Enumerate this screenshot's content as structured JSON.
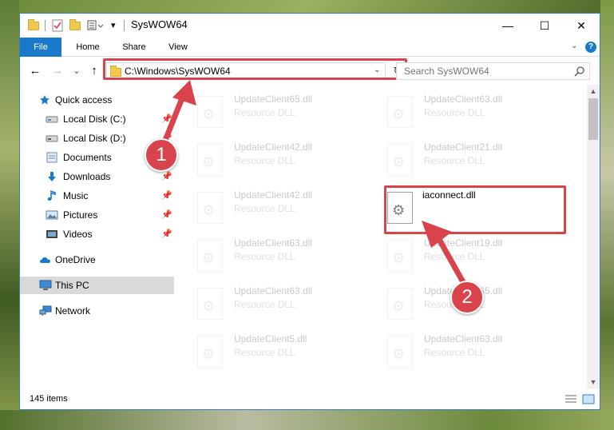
{
  "window": {
    "title": "SysWOW64",
    "minimize": "—",
    "maximize": "☐",
    "close": "✕"
  },
  "ribbon": {
    "tabs": [
      {
        "label": "File"
      },
      {
        "label": "Home"
      },
      {
        "label": "Share"
      },
      {
        "label": "View"
      }
    ],
    "help": "?"
  },
  "navigation": {
    "back": "←",
    "forward": "→",
    "recent": "⌄",
    "up": "↑",
    "address": "C:\\Windows\\SysWOW64",
    "refresh": "↻",
    "search_placeholder": "Search SysWOW64"
  },
  "nav_pane": {
    "items": [
      {
        "label": "Quick access",
        "icon": "star-icon"
      },
      {
        "label": "Local Disk (C:)",
        "icon": "drive-icon",
        "pinned": true
      },
      {
        "label": "Local Disk (D:)",
        "icon": "drive-icon",
        "pinned": true
      },
      {
        "label": "Documents",
        "icon": "documents-icon",
        "pinned": true
      },
      {
        "label": "Downloads",
        "icon": "download-icon",
        "pinned": true
      },
      {
        "label": "Music",
        "icon": "music-icon",
        "pinned": true
      },
      {
        "label": "Pictures",
        "icon": "pictures-icon",
        "pinned": true
      },
      {
        "label": "Videos",
        "icon": "videos-icon",
        "pinned": true
      },
      {
        "label": "OneDrive",
        "icon": "cloud-icon"
      },
      {
        "label": "This PC",
        "icon": "computer-icon"
      },
      {
        "label": "Network",
        "icon": "network-icon"
      }
    ]
  },
  "files": [
    {
      "name": "UpdateClient65.dll",
      "type": "Resource DLL"
    },
    {
      "name": "UpdateClient63.dll",
      "type": "Resource DLL"
    },
    {
      "name": "UpdateClient42.dll",
      "type": "Resource DLL"
    },
    {
      "name": "UpdateClient21.dll",
      "type": "Resource DLL"
    },
    {
      "name": "UpdateClient42.dll",
      "type": "Resource DLL"
    },
    {
      "name": "iaconnect.dll",
      "type": ""
    },
    {
      "name": "UpdateClient63.dll",
      "type": "Resource DLL"
    },
    {
      "name": "UpdateClient19.dll",
      "type": "Resource DLL"
    },
    {
      "name": "UpdateClient63.dll",
      "type": "Resource DLL"
    },
    {
      "name": "UpdateClient65.dll",
      "type": "Resource DLL"
    },
    {
      "name": "UpdateClient5.dll",
      "type": "Resource DLL"
    },
    {
      "name": "UpdateClient63.dll",
      "type": "Resource DLL"
    }
  ],
  "status": {
    "item_count": "145 items"
  },
  "annotations": {
    "step1": "1",
    "step2": "2",
    "color": "#d9434b"
  }
}
